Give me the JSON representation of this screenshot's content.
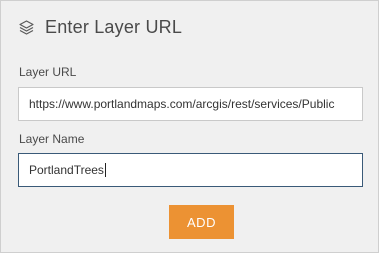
{
  "header": {
    "title": "Enter Layer URL",
    "icon": "layers-icon"
  },
  "layer_url": {
    "label": "Layer URL",
    "value": "https://www.portlandmaps.com/arcgis/rest/services/Public"
  },
  "layer_name": {
    "label": "Layer Name",
    "value": "PortlandTrees"
  },
  "add_button": {
    "label": "ADD",
    "color": "#ec9233"
  }
}
